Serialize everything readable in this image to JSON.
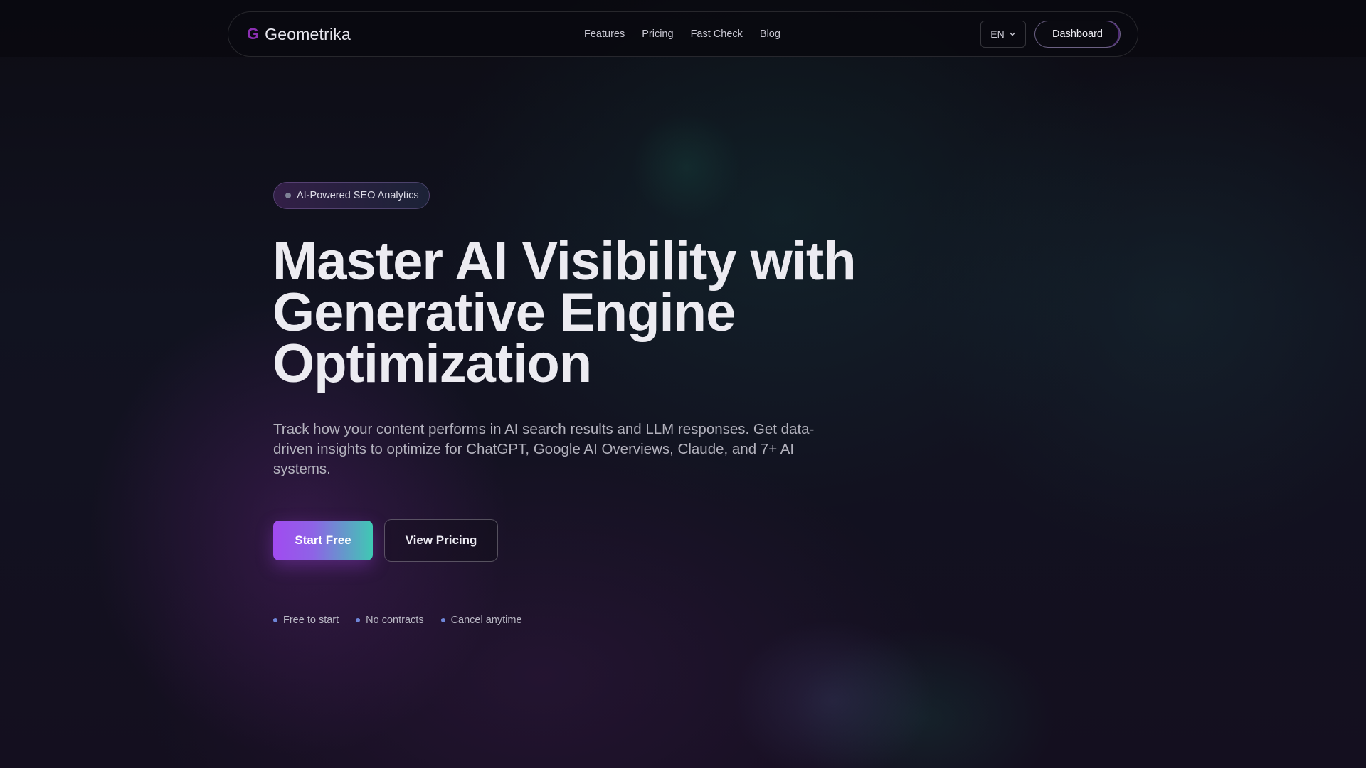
{
  "nav": {
    "brand_mark": "G",
    "brand_name": "Geometrika",
    "links": [
      "Features",
      "Pricing",
      "Fast Check",
      "Blog"
    ],
    "language": "EN",
    "dashboard_label": "Dashboard"
  },
  "hero": {
    "badge": "AI-Powered SEO Analytics",
    "headline_lines": [
      "Master AI Visibility with",
      "Generative Engine",
      "Optimization"
    ],
    "subtitle": "Track how your content performs in AI search results and LLM responses. Get data-driven insights to optimize for ChatGPT, Google AI Overviews, Claude, and 7+ AI systems.",
    "primary_cta": "Start Free",
    "secondary_cta": "View Pricing",
    "perks": [
      "Free to start",
      "No contracts",
      "Cancel anytime"
    ]
  },
  "colors": {
    "brand_mark": "#8b2fb2",
    "cta_gradient_start": "#a14bf0",
    "cta_gradient_end": "#3fc9b3",
    "perk_dot": "#6f86d8"
  },
  "icons": {
    "language_dropdown": "chevron-down-icon"
  }
}
